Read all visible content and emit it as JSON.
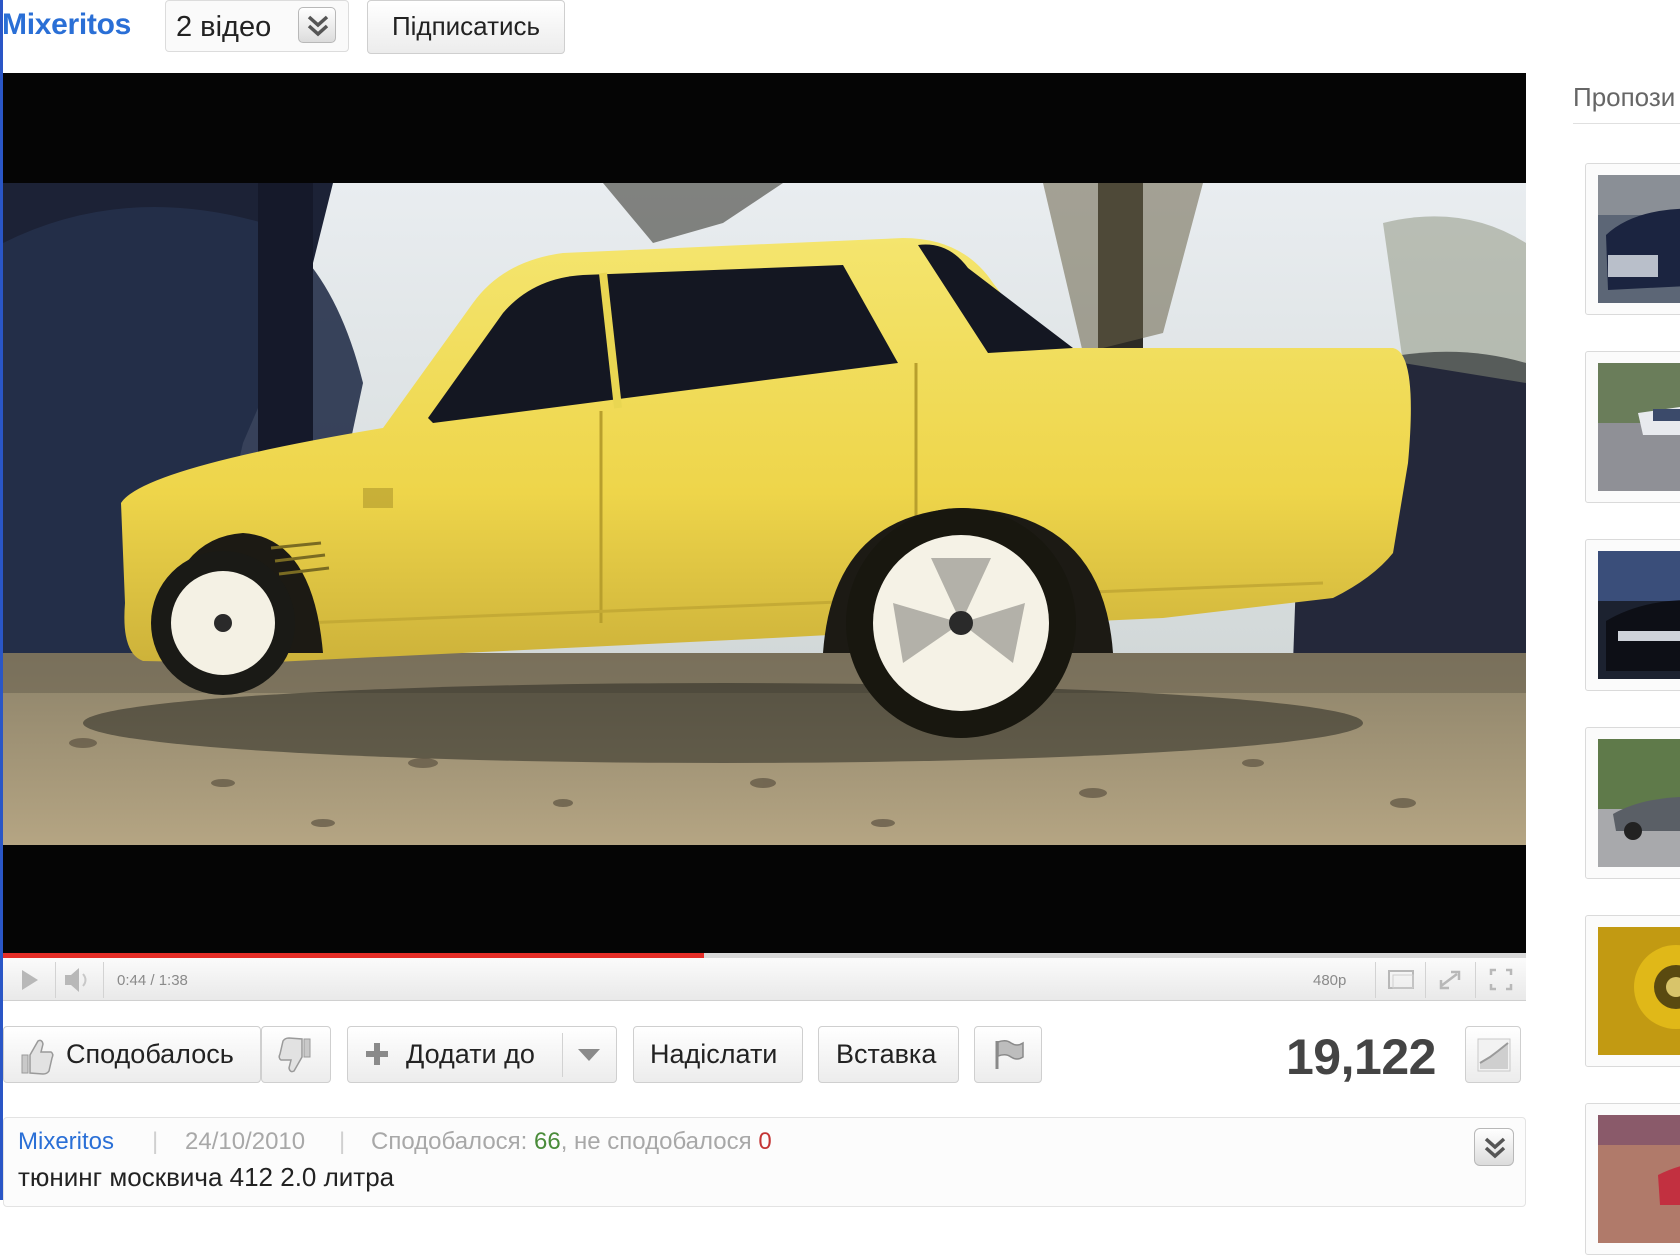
{
  "channel": {
    "name": "Mixeritos",
    "video_count": "2 відео",
    "subscribe_label": "Підписатись"
  },
  "player": {
    "time": "0:44 / 1:38",
    "quality": "480p",
    "progress_fraction": 0.46
  },
  "actions": {
    "like_label": "Сподобалось",
    "add_to_label": "Додати до",
    "share_label": "Надіслати",
    "embed_label": "Вставка",
    "view_count": "19,122"
  },
  "info": {
    "author": "Mixeritos",
    "date": "24/10/2010",
    "likes_prefix": "Сподобалося: ",
    "likes_count": "66",
    "dislikes_prefix": ", не сподобалося ",
    "dislikes_count": "0",
    "title": "тюнинг москвича 412 2.0 литра"
  },
  "sidebar": {
    "title": "Пропози"
  },
  "colors": {
    "link_blue": "#2a6fd6",
    "progress_red": "#e52d27",
    "like_green": "#4a8c3a",
    "dislike_red": "#c43434"
  }
}
